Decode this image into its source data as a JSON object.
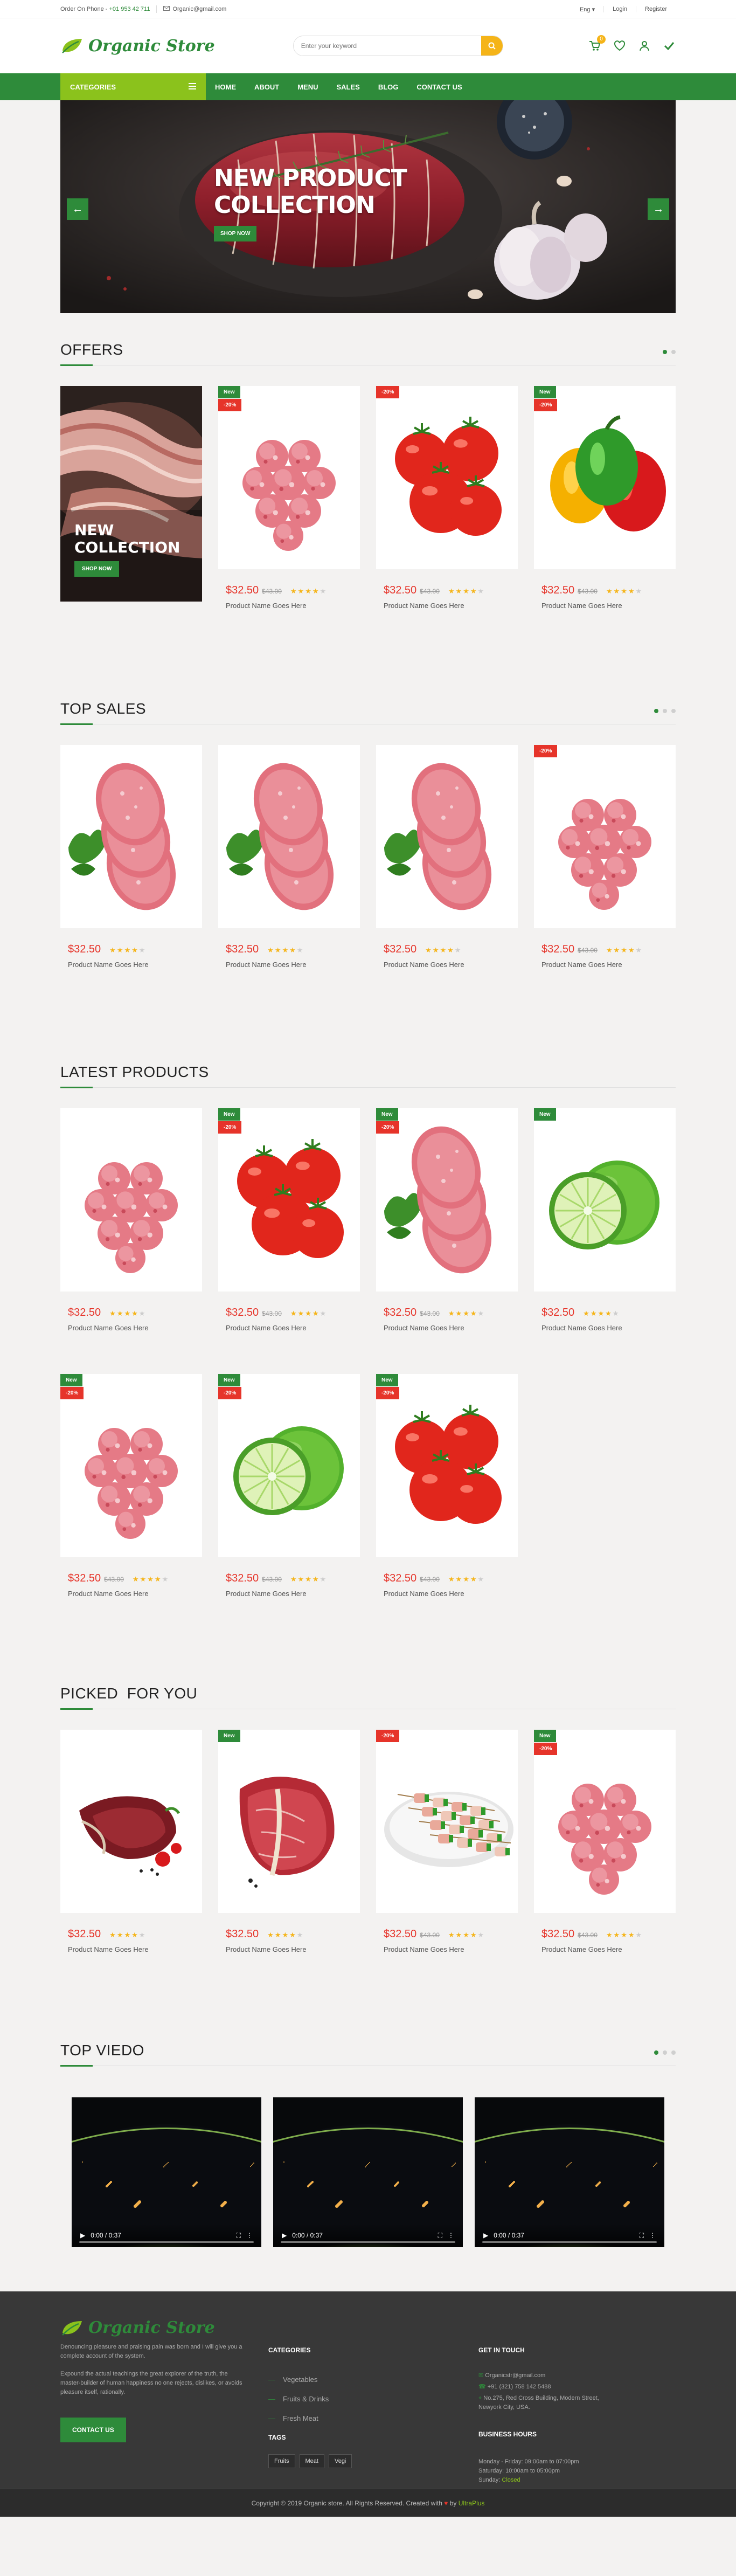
{
  "topbar": {
    "phone_label": "Order On Phone - ",
    "phone": "+01 953 42 711",
    "email": "Organic@gmail.com",
    "lang": "Eng ▾",
    "login": "Login",
    "register": "Register"
  },
  "header": {
    "logo": "Organic Store",
    "search_placeholder": "Enter your keyword",
    "cart_count": "0"
  },
  "nav": {
    "categories": "CATEGORIES",
    "menu": [
      "HOME",
      "ABOUT",
      "MENU",
      "SALES",
      "BLOG",
      "CONTACT US"
    ]
  },
  "hero": {
    "title_line1": "NEW PRODUCT",
    "title_line2": "COLLECTION",
    "button": "SHOP NOW"
  },
  "offers": {
    "title": "OFFERS",
    "promo_line1": "NEW",
    "promo_line2": "COLLECTION",
    "promo_button": "SHOP NOW",
    "products": [
      {
        "img": "meatballs",
        "new": "New",
        "sale": "-20%",
        "price": "$32.50",
        "old": "$43.00",
        "rating": 4,
        "name": "Product Name Goes Here"
      },
      {
        "img": "tomatoes",
        "new": "",
        "sale": "-20%",
        "price": "$32.50",
        "old": "$43.00",
        "rating": 4,
        "name": "Product Name Goes Here"
      },
      {
        "img": "peppers",
        "new": "New",
        "sale": "-20%",
        "price": "$32.50",
        "old": "$43.00",
        "rating": 4,
        "name": "Product Name Goes Here"
      }
    ]
  },
  "top_sales": {
    "title": "TOP SALES",
    "products": [
      {
        "img": "patties",
        "new": "",
        "sale": "",
        "price": "$32.50",
        "old": "",
        "rating": 4,
        "name": "Product Name Goes Here"
      },
      {
        "img": "patties",
        "new": "",
        "sale": "",
        "price": "$32.50",
        "old": "",
        "rating": 4,
        "name": "Product Name Goes Here"
      },
      {
        "img": "patties",
        "new": "",
        "sale": "",
        "price": "$32.50",
        "old": "",
        "rating": 4,
        "name": "Product Name Goes Here"
      },
      {
        "img": "meatballs",
        "new": "",
        "sale": "-20%",
        "price": "$32.50",
        "old": "$43.00",
        "rating": 4,
        "name": "Product Name Goes Here"
      }
    ]
  },
  "latest": {
    "title": "LATEST PRODUCTS",
    "products": [
      {
        "img": "meatballs",
        "new": "",
        "sale": "",
        "price": "$32.50",
        "old": "",
        "rating": 4,
        "name": "Product Name Goes Here"
      },
      {
        "img": "tomatoes",
        "new": "New",
        "sale": "-20%",
        "price": "$32.50",
        "old": "$43.00",
        "rating": 4,
        "name": "Product Name Goes Here"
      },
      {
        "img": "patties",
        "new": "New",
        "sale": "-20%",
        "price": "$32.50",
        "old": "$43.00",
        "rating": 4,
        "name": "Product Name Goes Here"
      },
      {
        "img": "limes",
        "new": "New",
        "sale": "",
        "price": "$32.50",
        "old": "",
        "rating": 4,
        "name": "Product Name Goes Here"
      },
      {
        "img": "meatballs",
        "new": "New",
        "sale": "-20%",
        "price": "$32.50",
        "old": "$43.00",
        "rating": 4,
        "name": "Product Name Goes Here"
      },
      {
        "img": "limes",
        "new": "New",
        "sale": "-20%",
        "price": "$32.50",
        "old": "$43.00",
        "rating": 4,
        "name": "Product Name Goes Here"
      },
      {
        "img": "tomatoes",
        "new": "New",
        "sale": "-20%",
        "price": "$32.50",
        "old": "$43.00",
        "rating": 4,
        "name": "Product Name Goes Here"
      }
    ]
  },
  "picked": {
    "title": "PICKED  FOR YOU",
    "products": [
      {
        "img": "steak",
        "new": "",
        "sale": "",
        "price": "$32.50",
        "old": "",
        "rating": 4,
        "name": "Product Name Goes Here"
      },
      {
        "img": "tbone",
        "new": "New",
        "sale": "",
        "price": "$32.50",
        "old": "",
        "rating": 4,
        "name": "Product Name Goes Here"
      },
      {
        "img": "skewers",
        "new": "",
        "sale": "-20%",
        "price": "$32.50",
        "old": "$43.00",
        "rating": 4,
        "name": "Product Name Goes Here"
      },
      {
        "img": "meatballs",
        "new": "New",
        "sale": "-20%",
        "price": "$32.50",
        "old": "$43.00",
        "rating": 4,
        "name": "Product Name Goes Here"
      }
    ]
  },
  "videos": {
    "title": "TOP VIEDO",
    "time": "0:00 / 0:37",
    "count": 3
  },
  "footer": {
    "logo": "Organic Store",
    "about1": "Denouncing pleasure and praising pain was born and I will give you a complete account of the system.",
    "about2": "Expound the actual teachings the great explorer of the truth, the master-builder of human happiness no one rejects, dislikes, or avoids pleasure itself, rationally.",
    "contact_button": "CONTACT US",
    "categories_title": "CATEGORIES",
    "categories": [
      "Vegetables",
      "Fruits & Drinks",
      "Fresh Meat"
    ],
    "tags_title": "TAGS",
    "tags": [
      "Fruits",
      "Meat",
      "Vegi"
    ],
    "touch_title": "GET IN TOUCH",
    "email": "Organicstr@gmail.com",
    "phone": "+91 (321) 758 142 5488",
    "address": "No.275, Red Cross Building, Modern Street, Newyork City, USA.",
    "hours_title": "BUSINESS HOURS",
    "hours1": "Monday - Friday: 09:00am to 07:00pm",
    "hours2": "Saturday: 10:00am to 05:00pm",
    "hours3_label": "Sunday: ",
    "hours3_value": "Closed",
    "copyright": "Copyright © 2019 Organic store. All Rights Reserved. Created with ",
    "copyright_by": " by ",
    "copyright_author": "UltraPlus"
  }
}
